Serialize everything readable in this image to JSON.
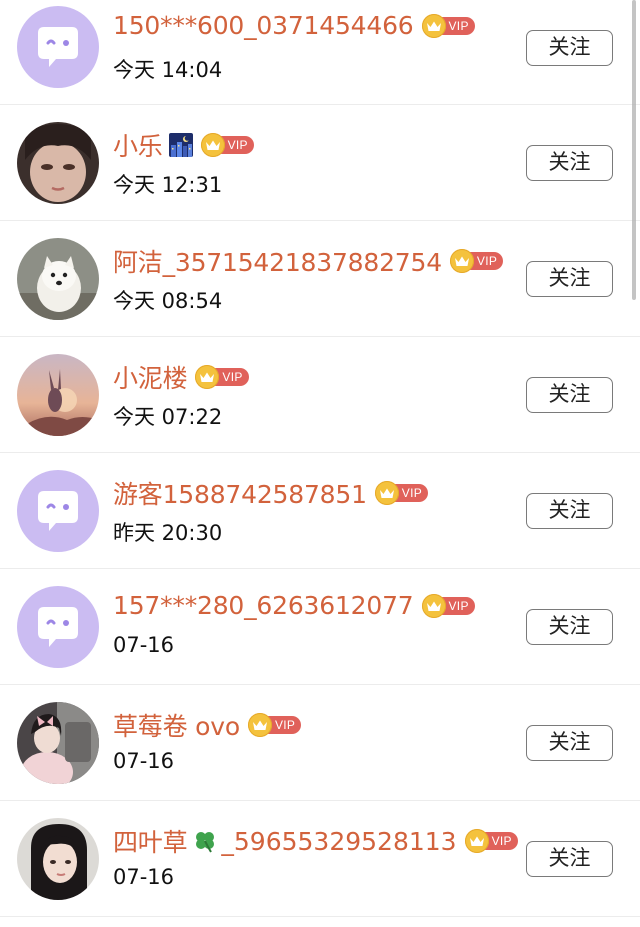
{
  "follow_label": "关注",
  "vip_text": "VIP",
  "users": [
    {
      "name": "150***600_0371454466",
      "name_emoji": "",
      "name_suffix": "",
      "time": "今天 14:04",
      "avatar": "default-chat-bubble"
    },
    {
      "name": "小乐",
      "name_emoji": "night-city-emoji",
      "name_suffix": "",
      "time": "今天 12:31",
      "avatar": "photo-girl-closeup"
    },
    {
      "name": "阿洁_35715421837882754",
      "name_emoji": "",
      "name_suffix": "",
      "time": "今天 08:54",
      "avatar": "photo-white-dog"
    },
    {
      "name": "小泥楼",
      "name_emoji": "",
      "name_suffix": "",
      "time": "今天 07:22",
      "avatar": "illustration-rabbit-sunset"
    },
    {
      "name": "游客1588742587851",
      "name_emoji": "",
      "name_suffix": "",
      "time": "昨天 20:30",
      "avatar": "default-chat-bubble"
    },
    {
      "name": "157***280_6263612077",
      "name_emoji": "",
      "name_suffix": "",
      "time": "07-16",
      "avatar": "default-chat-bubble"
    },
    {
      "name": "草莓卷 ovo",
      "name_emoji": "",
      "name_suffix": "",
      "time": "07-16",
      "avatar": "photo-girl-bow"
    },
    {
      "name": "四叶草",
      "name_emoji": "four-leaf-clover-emoji",
      "name_suffix": "_59655329528113",
      "time": "07-16",
      "avatar": "photo-girl-portrait"
    }
  ],
  "colors": {
    "name": "#d2623c",
    "vip_tag": "#e0615a",
    "vip_crown": "#f4c23d",
    "default_avatar_bg": "#cbbcf2"
  }
}
